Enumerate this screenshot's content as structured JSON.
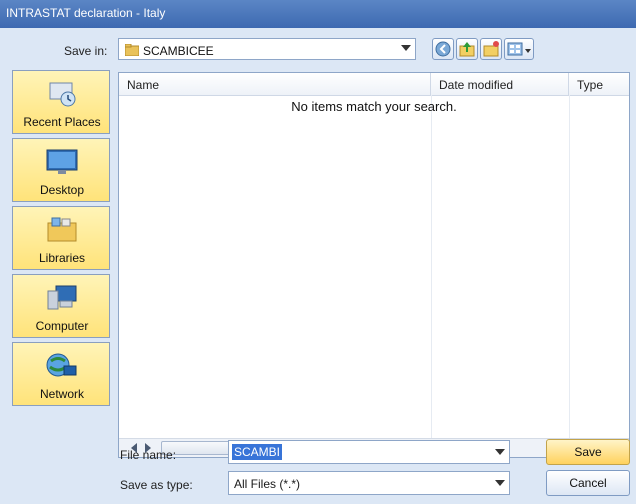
{
  "window": {
    "title": "INTRASTAT declaration - Italy"
  },
  "save_in": {
    "label": "Save in:",
    "folder": "SCAMBICEE"
  },
  "toolbar_buttons": [
    {
      "name": "back-icon"
    },
    {
      "name": "up-folder-icon"
    },
    {
      "name": "new-folder-icon"
    },
    {
      "name": "view-menu-icon"
    }
  ],
  "places": [
    {
      "label": "Recent Places",
      "icon": "recent-places-icon"
    },
    {
      "label": "Desktop",
      "icon": "desktop-icon"
    },
    {
      "label": "Libraries",
      "icon": "libraries-icon"
    },
    {
      "label": "Computer",
      "icon": "computer-icon"
    },
    {
      "label": "Network",
      "icon": "network-icon"
    }
  ],
  "file_list": {
    "columns": [
      "Name",
      "Date modified",
      "Type"
    ],
    "empty_message": "No items match your search."
  },
  "file_name": {
    "label": "File name:",
    "value": "SCAMBI"
  },
  "save_as_type": {
    "label": "Save as type:",
    "value": "All Files (*.*)"
  },
  "buttons": {
    "save": "Save",
    "cancel": "Cancel"
  },
  "colors": {
    "titlebar": "#3d69b1",
    "dialog_bg": "#dce7f5",
    "place_bg": "#ffe37a",
    "selection": "#3874d8"
  }
}
